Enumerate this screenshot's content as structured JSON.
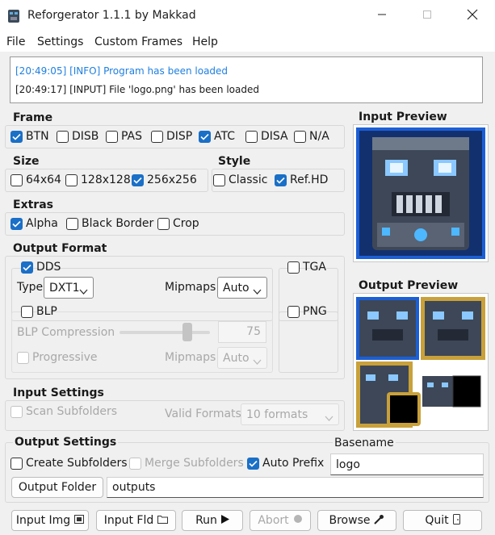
{
  "window": {
    "title": "Reforgerator 1.1.1 by Makkad",
    "minimize_icon": "minimize-icon",
    "maximize_icon": "maximize-icon",
    "close_icon": "close-icon"
  },
  "menu": [
    "File",
    "Settings",
    "Custom Frames",
    "Help"
  ],
  "log": {
    "lines": [
      {
        "text": "[20:49:05] [INFO] Program has been loaded",
        "color": "#1f7fe0"
      },
      {
        "text": "[20:49:17] [INPUT] File 'logo.png' has been loaded",
        "color": "#1a1a1a"
      }
    ]
  },
  "frame": {
    "title": "Frame",
    "options": [
      {
        "label": "BTN",
        "checked": true
      },
      {
        "label": "DISB",
        "checked": false
      },
      {
        "label": "PAS",
        "checked": false
      },
      {
        "label": "DISP",
        "checked": false
      },
      {
        "label": "ATC",
        "checked": true
      },
      {
        "label": "DISA",
        "checked": false
      },
      {
        "label": "N/A",
        "checked": false
      }
    ]
  },
  "size": {
    "title": "Size",
    "options": [
      {
        "label": "64x64",
        "checked": false
      },
      {
        "label": "128x128",
        "checked": false
      },
      {
        "label": "256x256",
        "checked": true
      }
    ]
  },
  "style": {
    "title": "Style",
    "options": [
      {
        "label": "Classic",
        "checked": false
      },
      {
        "label": "Ref.HD",
        "checked": true
      }
    ]
  },
  "extras": {
    "title": "Extras",
    "options": [
      {
        "label": "Alpha",
        "checked": true
      },
      {
        "label": "Black Border",
        "checked": false
      },
      {
        "label": "Crop",
        "checked": false
      }
    ]
  },
  "output_format": {
    "title": "Output Format",
    "dds": {
      "label": "DDS",
      "checked": true
    },
    "type_label": "Type",
    "type_value": "DXT1",
    "mipmaps_label": "Mipmaps",
    "mipmaps_value": "Auto",
    "tga": {
      "label": "TGA",
      "checked": false
    },
    "blp": {
      "label": "BLP",
      "checked": false
    },
    "blp_compression_label": "BLP Compression",
    "blp_compression_value": "75",
    "blp_compression_fraction": 0.75,
    "progressive": {
      "label": "Progressive",
      "checked": false
    },
    "blp_mipmaps_label": "Mipmaps",
    "blp_mipmaps_value": "Auto",
    "png": {
      "label": "PNG",
      "checked": false
    }
  },
  "input_settings": {
    "title": "Input Settings",
    "scan_subfolders": {
      "label": "Scan Subfolders",
      "checked": false
    },
    "valid_formats_label": "Valid Formats",
    "valid_formats_value": "10 formats"
  },
  "output_settings": {
    "title": "Output Settings",
    "create_subfolders": {
      "label": "Create Subfolders",
      "checked": false
    },
    "merge_subfolders": {
      "label": "Merge Subfolders",
      "checked": false
    },
    "auto_prefix": {
      "label": "Auto Prefix",
      "checked": true
    },
    "basename_label": "Basename",
    "basename_value": "logo",
    "output_folder_button": "Output Folder",
    "output_folder_value": "outputs"
  },
  "previews": {
    "input_title": "Input Preview",
    "output_title": "Output Preview"
  },
  "buttons": {
    "input_img": "Input Img",
    "input_fld": "Input Fld",
    "run": "Run",
    "abort": "Abort",
    "browse": "Browse",
    "quit": "Quit"
  },
  "colors": {
    "accent": "#1a6fc7",
    "info_text": "#1f7fe0",
    "preview_blue": "#1b5fd6",
    "frame_gold": "#c9a13b"
  }
}
